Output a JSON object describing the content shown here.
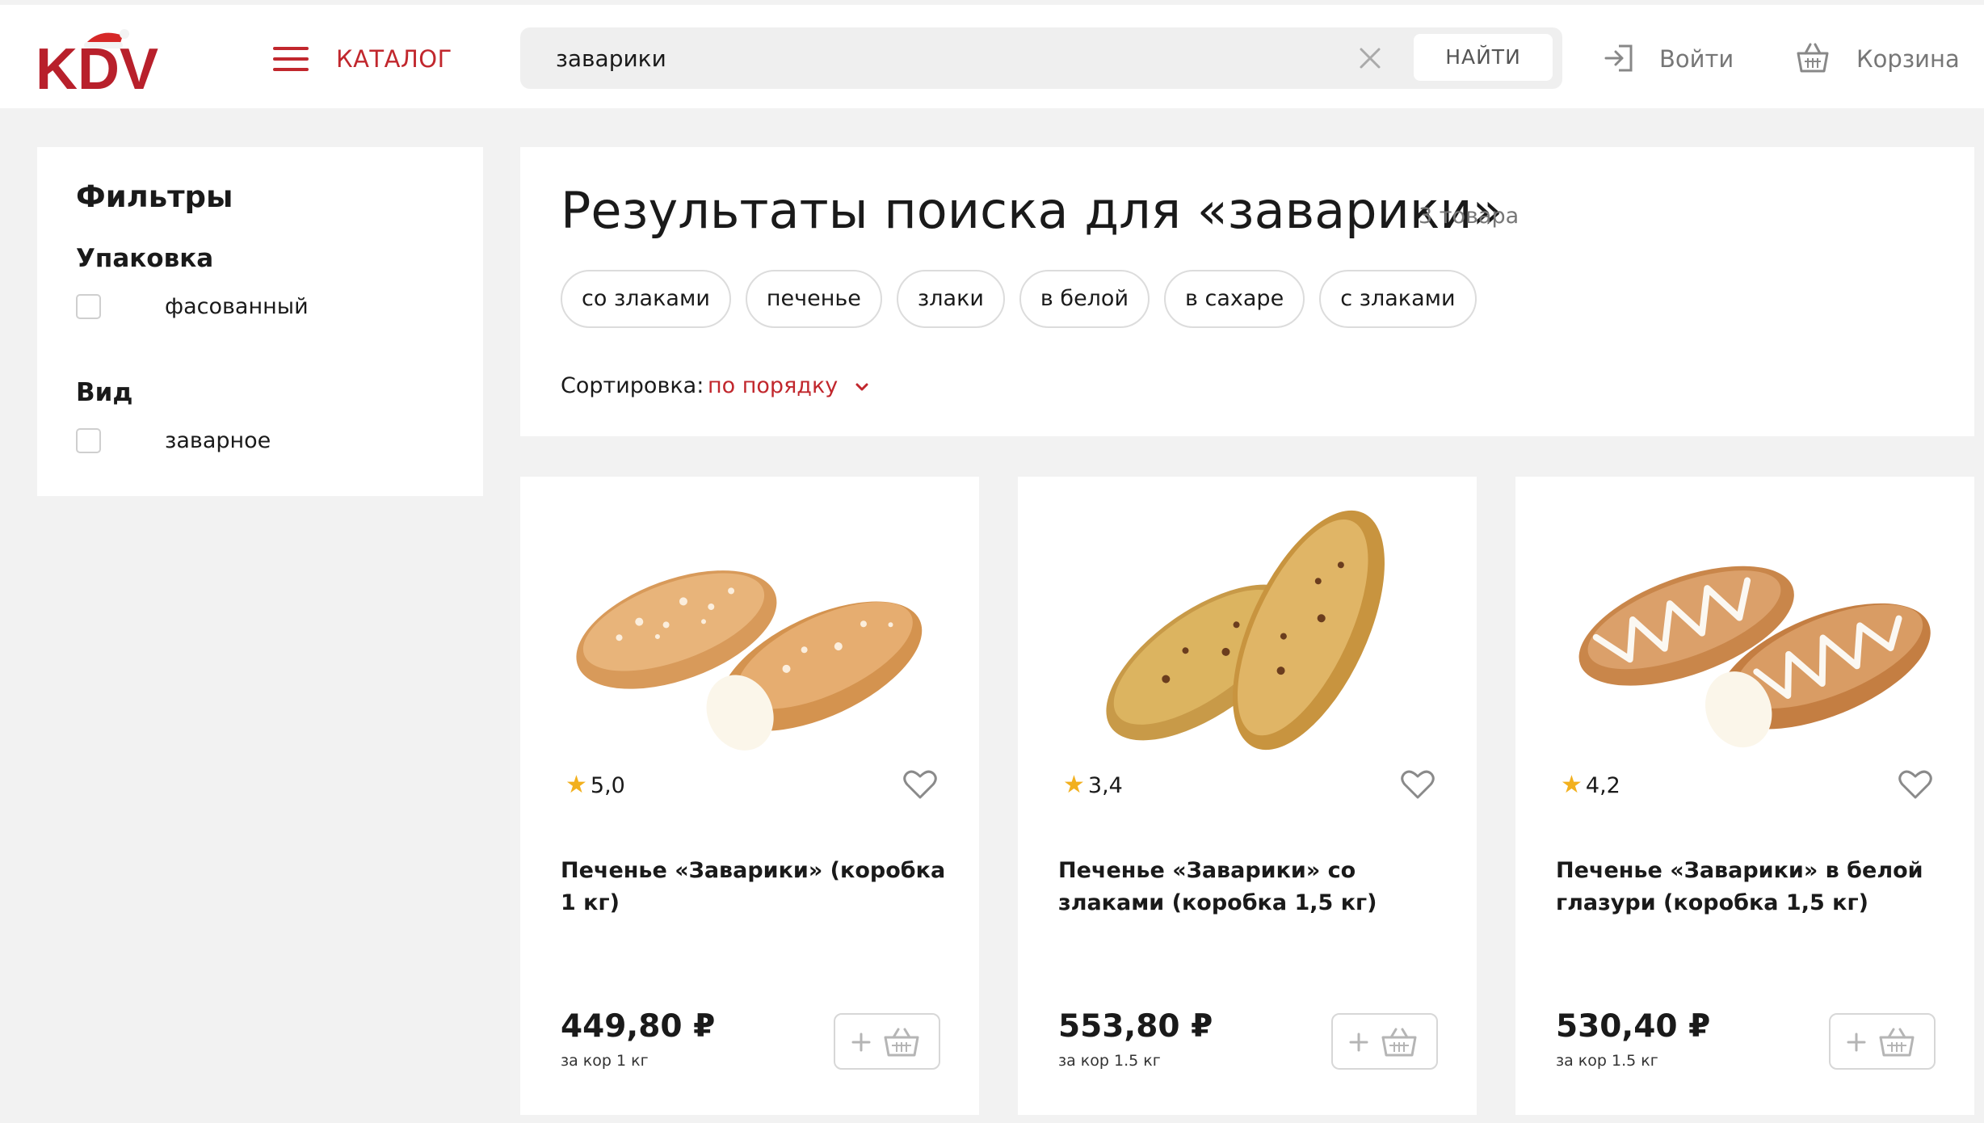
{
  "brand": {
    "logo_text": "KDV",
    "accent": "#c1272d"
  },
  "header": {
    "catalog_label": "КАТАЛОГ",
    "search_value": "заварики",
    "search_button": "НАЙТИ",
    "login_label": "Войти",
    "cart_label": "Корзина"
  },
  "filters": {
    "title": "Фильтры",
    "groups": [
      {
        "title": "Упаковка",
        "options": [
          {
            "label": "фасованный",
            "checked": false
          }
        ]
      },
      {
        "title": "Вид",
        "options": [
          {
            "label": "заварное",
            "checked": false
          }
        ]
      }
    ]
  },
  "results": {
    "title": "Результаты поиска для «заварики»",
    "count": "3 товара",
    "chips": [
      "со злаками",
      "печенье",
      "злаки",
      "в белой",
      "в сахаре",
      "с злаками"
    ],
    "sort_label": "Сортировка:",
    "sort_value": "по порядку"
  },
  "products": [
    {
      "rating": "5,0",
      "name": "Печенье «Заварики» (коробка 1 кг)",
      "price": "449,80 ₽",
      "unit": "за кор 1 кг",
      "image": "sugar-topped-pastry"
    },
    {
      "rating": "3,4",
      "name": "Печенье «Заварики» со злаками (коробка 1,5 кг)",
      "price": "553,80 ₽",
      "unit": "за кор 1.5 кг",
      "image": "cereal-pastry"
    },
    {
      "rating": "4,2",
      "name": "Печенье «Заварики» в белой глазури (коробка 1,5 кг)",
      "price": "530,40 ₽",
      "unit": "за кор 1.5 кг",
      "image": "glazed-pastry"
    }
  ]
}
